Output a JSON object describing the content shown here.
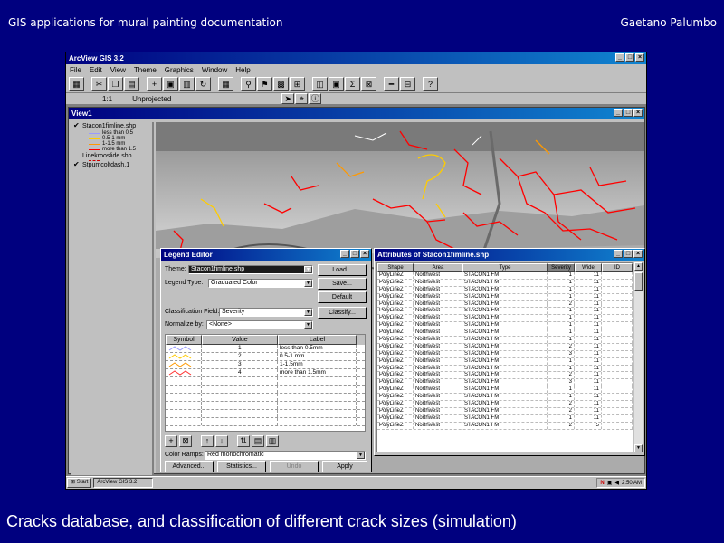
{
  "slide": {
    "header_left": "GIS applications for mural painting documentation",
    "header_right": "Gaetano Palumbo",
    "caption": "Cracks database, and classification of different crack sizes (simulation)"
  },
  "app": {
    "title": "ArcView GIS 3.2",
    "menus": [
      "File",
      "Edit",
      "View",
      "Theme",
      "Graphics",
      "Window",
      "Help"
    ],
    "scale_label": "1:1",
    "unit_label": "Unprojected"
  },
  "view": {
    "title": "View1",
    "themes": [
      {
        "name": "Stacon1fimline.shp",
        "checked": true,
        "legend": [
          {
            "label": "less than 0.5",
            "color": "#9999ff"
          },
          {
            "label": "0.5-1 mm",
            "color": "#ffcc00"
          },
          {
            "label": "1-1.5 mm",
            "color": "#ff9900"
          },
          {
            "label": "more than 1.5",
            "color": "#ff0000"
          }
        ]
      },
      {
        "name": "Linekrooslide.shp",
        "checked": false,
        "legend": []
      },
      {
        "name": "Stpumcoltdash.1",
        "checked": true,
        "legend": []
      }
    ]
  },
  "legend_editor": {
    "title": "Legend Editor",
    "theme_label": "Theme:",
    "theme_value": "Stacon1fimline.shp",
    "legend_type_label": "Legend Type:",
    "legend_type_value": "Graduated Color",
    "classification_label": "Classification Field:",
    "classification_value": "Severity",
    "normalize_label": "Normalize by:",
    "normalize_value": "<None>",
    "columns": [
      "Symbol",
      "Value",
      "Label"
    ],
    "rows": [
      {
        "value": "1",
        "label": "less than 0.5mm",
        "color": "#9999ff"
      },
      {
        "value": "2",
        "label": "0.5-1 mm",
        "color": "#ffcc00"
      },
      {
        "value": "3",
        "label": "1-1.5mm",
        "color": "#ff9900"
      },
      {
        "value": "4",
        "label": "more than 1.5mm",
        "color": "#ff3333"
      }
    ],
    "color_ramps_label": "Color Ramps:",
    "color_ramps_value": "Red monochromatic",
    "buttons": {
      "load": "Load...",
      "save": "Save...",
      "default": "Default",
      "classify": "Classify...",
      "advanced": "Advanced...",
      "statistics": "Statistics...",
      "undo": "Undo",
      "apply": "Apply"
    }
  },
  "attributes": {
    "title": "Attributes of Stacon1fimline.shp",
    "columns": [
      "Shape",
      "Area",
      "Type",
      "Severity",
      "Wide",
      "ID"
    ],
    "rows": [
      [
        "PolyLineZ",
        "Northwest",
        "STACON1 FM",
        "1",
        "11",
        ""
      ],
      [
        "PolyLineZ",
        "Northwest",
        "STACON1 FM",
        "1",
        "11",
        ""
      ],
      [
        "PolyLineZ",
        "Northwest",
        "STACON1 FM",
        "1",
        "11",
        ""
      ],
      [
        "PolyLineZ",
        "Northwest",
        "STACON1 FM",
        "1",
        "11",
        ""
      ],
      [
        "PolyLineZ",
        "Northwest",
        "STACON1 FM",
        "2",
        "11",
        ""
      ],
      [
        "PolyLineZ",
        "Northwest",
        "STACON1 FM",
        "1",
        "11",
        ""
      ],
      [
        "PolyLineZ",
        "Northwest",
        "STACON1 FM",
        "1",
        "11",
        ""
      ],
      [
        "PolyLineZ",
        "Northwest",
        "STACON1 FM",
        "1",
        "11",
        ""
      ],
      [
        "PolyLineZ",
        "Northwest",
        "STACON1 FM",
        "1",
        "11",
        ""
      ],
      [
        "PolyLineZ",
        "Northwest",
        "STACON1 FM",
        "1",
        "11",
        ""
      ],
      [
        "PolyLineZ",
        "Northwest",
        "STACON1 FM",
        "2",
        "11",
        ""
      ],
      [
        "PolyLineZ",
        "Northwest",
        "STACON1 FM",
        "3",
        "11",
        ""
      ],
      [
        "PolyLineZ",
        "Northwest",
        "STACON1 FM",
        "1",
        "11",
        ""
      ],
      [
        "PolyLineZ",
        "Northwest",
        "STACON1 FM",
        "1",
        "11",
        ""
      ],
      [
        "PolyLineZ",
        "Northwest",
        "STACON1 FM",
        "2",
        "11",
        ""
      ],
      [
        "PolyLineZ",
        "Northwest",
        "STACON1 FM",
        "3",
        "11",
        ""
      ],
      [
        "PolyLineZ",
        "Northwest",
        "STACON1 FM",
        "1",
        "11",
        ""
      ],
      [
        "PolyLineZ",
        "Northwest",
        "STACON1 FM",
        "1",
        "11",
        ""
      ],
      [
        "PolyLineZ",
        "Northwest",
        "STACON1 FM",
        "2",
        "11",
        ""
      ],
      [
        "PolyLineZ",
        "Northwest",
        "STACON1 FM",
        "2",
        "11",
        ""
      ],
      [
        "PolyLineZ",
        "Northwest",
        "STACON1 FM",
        "1",
        "11",
        ""
      ],
      [
        "PolyLineZ",
        "Northwest",
        "STACON1 FM",
        "2",
        "5",
        ""
      ]
    ]
  },
  "taskbar": {
    "start": "Start",
    "task": "ArcView GIS 3.2",
    "clock": "2:50 AM"
  }
}
